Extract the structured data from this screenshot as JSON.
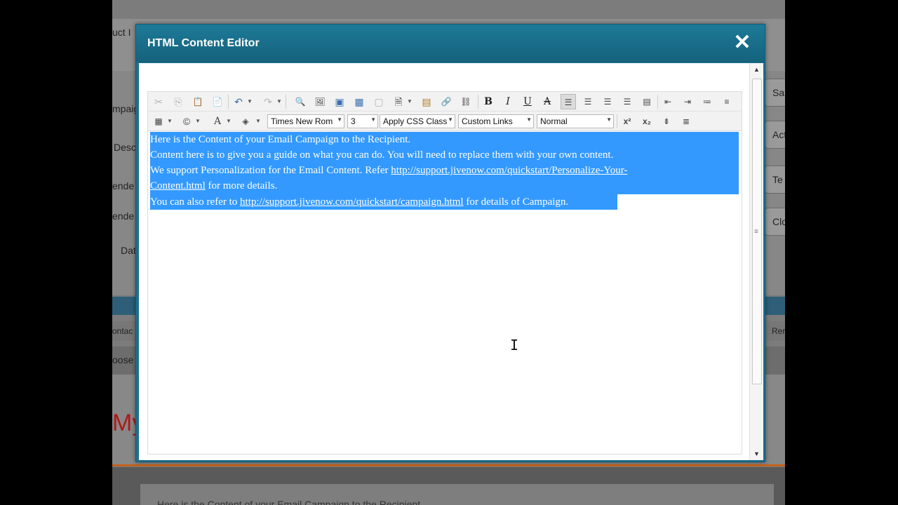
{
  "background": {
    "labels": [
      "uct I",
      "mpaig",
      "Desc",
      "ende",
      "ende",
      "Dat",
      "ontac",
      "oose"
    ],
    "right_buttons": [
      "Sa",
      "Activ",
      "Te",
      "Clo",
      "Rer"
    ],
    "big_text": "My",
    "footer_text": "Here is the Content of your Email Campaign to the Recipient"
  },
  "modal": {
    "title": "HTML Content Editor",
    "close_symbol": "✕"
  },
  "toolbar": {
    "row1": [
      {
        "name": "cut-icon",
        "glyph": "✂",
        "disabled": true
      },
      {
        "name": "copy-icon",
        "glyph": "⎘",
        "disabled": true
      },
      {
        "name": "paste-icon",
        "glyph": "📋",
        "disabled": true
      },
      {
        "name": "paste-text-icon",
        "glyph": "📄",
        "disabled": false
      },
      {
        "name": "undo-icon",
        "glyph": "↶",
        "disabled": false
      },
      {
        "name": "redo-icon",
        "glyph": "↷",
        "disabled": true
      },
      {
        "name": "find-replace-icon",
        "glyph": "🔍",
        "disabled": false
      },
      {
        "name": "image-manager-icon",
        "glyph": "🖼",
        "disabled": false
      },
      {
        "name": "insert-image-icon",
        "glyph": "▣",
        "disabled": false
      },
      {
        "name": "image-map-icon",
        "glyph": "▦",
        "disabled": false
      },
      {
        "name": "template-icon",
        "glyph": "▢",
        "disabled": true
      },
      {
        "name": "document-manager-icon",
        "glyph": "🗎",
        "disabled": false
      },
      {
        "name": "media-icon",
        "glyph": "▤",
        "disabled": false
      },
      {
        "name": "hyperlink-icon",
        "glyph": "🔗",
        "disabled": false
      },
      {
        "name": "unlink-icon",
        "glyph": "⛓",
        "disabled": false
      }
    ],
    "format": {
      "bold": "B",
      "italic": "I",
      "underline": "U",
      "strikethrough": "A"
    },
    "row2_icons": [
      "table-icon",
      "copyright-icon",
      "font-color-icon",
      "highlight-icon"
    ],
    "font_name": "Times New Rom",
    "font_size": "3",
    "css_class": "Apply CSS Class",
    "custom_links": "Custom Links",
    "paragraph_style": "Normal",
    "superscript": "x²",
    "subscript": "x₂"
  },
  "content": {
    "lines": [
      {
        "text": "Here is the Content of your Email Campaign to the Recipient."
      },
      {
        "text": "Content here is to give you a guide on what you can do. You will need to replace them with your own content."
      },
      {
        "prefix": "We support Personalization for the Email Content. Refer ",
        "link": "http://support.jivenow.com/quickstart/Personalize-Your-"
      },
      {
        "link": "Content.html",
        "suffix": " for more details."
      },
      {
        "prefix": "You can also refer to ",
        "link": "http://support.jivenow.com/quickstart/campaign.html",
        "suffix": " for details of Campaign."
      }
    ]
  },
  "colors": {
    "modal_header": "#1d7a98",
    "selection": "#3399ff"
  }
}
